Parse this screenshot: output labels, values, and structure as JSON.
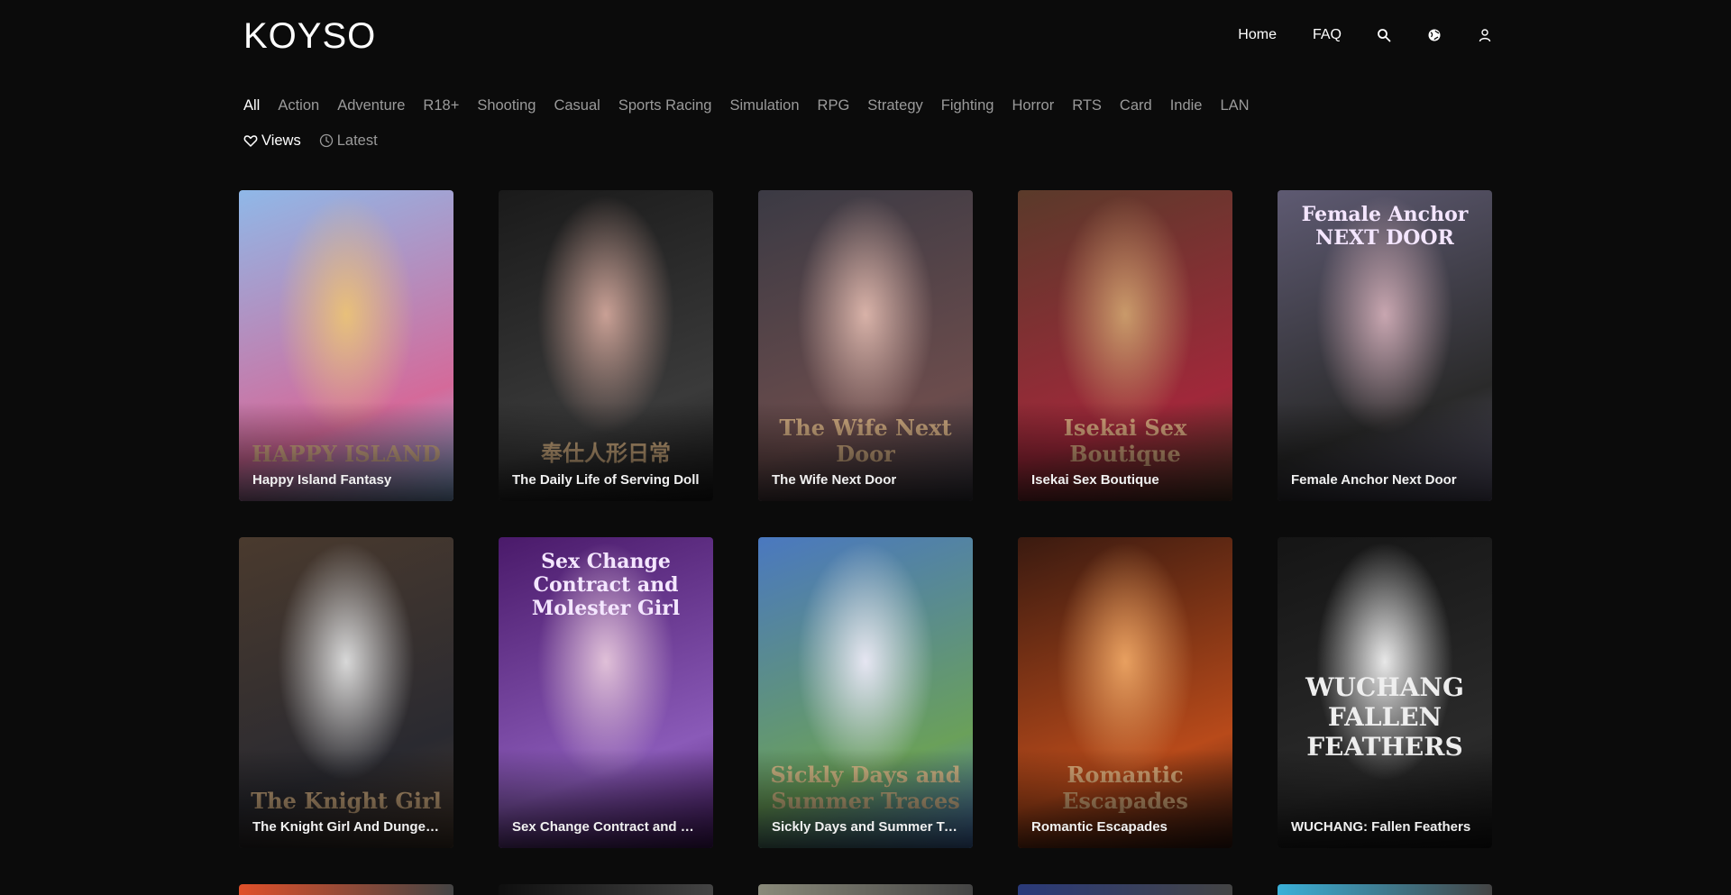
{
  "header": {
    "logo": "KOYSO",
    "nav": {
      "home": "Home",
      "faq": "FAQ"
    },
    "icons": [
      "search-icon",
      "globe-icon",
      "user-icon"
    ]
  },
  "categories": [
    "All",
    "Action",
    "Adventure",
    "R18+",
    "Shooting",
    "Casual",
    "Sports Racing",
    "Simulation",
    "RPG",
    "Strategy",
    "Fighting",
    "Horror",
    "RTS",
    "Card",
    "Indie",
    "LAN"
  ],
  "active_category": "All",
  "sort": {
    "views": "Views",
    "latest": "Latest",
    "active": "Views"
  },
  "games": [
    {
      "title": "Happy Island Fantasy",
      "cover_text": "HAPPY ISLAND",
      "colors": [
        "#8fb8e8",
        "#d46a9a",
        "#e8c07a"
      ]
    },
    {
      "title": "The Daily Life of Serving Doll",
      "cover_text": "奉仕人形日常",
      "colors": [
        "#1a1a1a",
        "#3a3a3a",
        "#c9a095"
      ]
    },
    {
      "title": "The Wife Next Door",
      "cover_text": "The Wife Next Door",
      "colors": [
        "#3b3a44",
        "#6b4c4c",
        "#d8b2a8"
      ]
    },
    {
      "title": "Isekai Sex Boutique",
      "cover_text": "Isekai Sex Boutique",
      "colors": [
        "#5a3a2a",
        "#a0283a",
        "#c99a6a"
      ]
    },
    {
      "title": "Female Anchor Next Door",
      "cover_text": "Female Anchor NEXT DOOR",
      "colors": [
        "#5e5a72",
        "#2a2a2a",
        "#c8a6b0"
      ]
    },
    {
      "title": "The Knight Girl And Dungeon Creatures",
      "cover_text": "The Knight Girl",
      "colors": [
        "#4a3a2e",
        "#2a2a30",
        "#d8d8d8"
      ]
    },
    {
      "title": "Sex Change Contract and Molester Girl",
      "cover_text": "Sex Change Contract and Molester Girl",
      "colors": [
        "#4a1a6a",
        "#8a5ab8",
        "#e0c0d8"
      ]
    },
    {
      "title": "Sickly Days and Summer Traces",
      "cover_text": "Sickly Days and Summer Traces",
      "colors": [
        "#4a78c0",
        "#6aa05a",
        "#e6e6f2"
      ]
    },
    {
      "title": "Romantic Escapades",
      "cover_text": "Romantic Escapades",
      "colors": [
        "#3a1a10",
        "#b84a1a",
        "#e8a060"
      ]
    },
    {
      "title": "WUCHANG: Fallen Feathers",
      "cover_text": "WUCHANG FALLEN FEATHERS",
      "colors": [
        "#151515",
        "#2a2a2a",
        "#e8e8e8"
      ]
    }
  ],
  "next_row_colors": [
    "#e0502a",
    "#0f0f0f",
    "#8a8a7a",
    "#2a3a7a",
    "#3ab0d8"
  ]
}
